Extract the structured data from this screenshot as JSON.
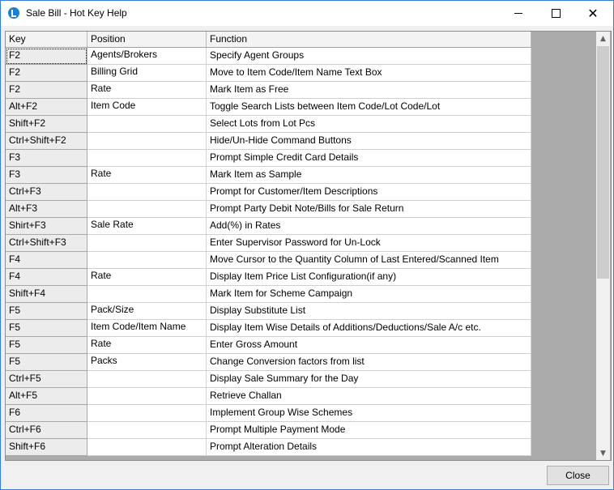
{
  "window": {
    "title": "Sale Bill - Hot Key Help",
    "icon": "app-logo-icon",
    "controls": {
      "minimize": "minimize-icon",
      "maximize": "maximize-icon",
      "close": "close-icon",
      "close_glyph": "✕"
    }
  },
  "grid": {
    "columns": [
      "Key",
      "Position",
      "Function"
    ],
    "rows": [
      {
        "key": "F2",
        "position": "Agents/Brokers",
        "function": "Specify Agent Groups"
      },
      {
        "key": "F2",
        "position": "Billing Grid",
        "function": "Move to Item Code/Item Name Text Box"
      },
      {
        "key": "F2",
        "position": "Rate",
        "function": "Mark Item as Free"
      },
      {
        "key": "Alt+F2",
        "position": "Item Code",
        "function": "Toggle Search Lists between Item Code/Lot Code/Lot"
      },
      {
        "key": "Shift+F2",
        "position": "",
        "function": "Select Lots from Lot Pcs"
      },
      {
        "key": "Ctrl+Shift+F2",
        "position": "",
        "function": "Hide/Un-Hide Command Buttons"
      },
      {
        "key": "F3",
        "position": "",
        "function": "Prompt Simple Credit Card Details"
      },
      {
        "key": "F3",
        "position": "Rate",
        "function": "Mark Item as Sample"
      },
      {
        "key": "Ctrl+F3",
        "position": "",
        "function": "Prompt for Customer/Item Descriptions"
      },
      {
        "key": "Alt+F3",
        "position": "",
        "function": "Prompt Party Debit Note/Bills for Sale Return"
      },
      {
        "key": "Shirt+F3",
        "position": "Sale Rate",
        "function": "Add(%) in Rates"
      },
      {
        "key": "Ctrl+Shift+F3",
        "position": "",
        "function": "Enter Supervisor Password for Un-Lock"
      },
      {
        "key": "F4",
        "position": "",
        "function": "Move Cursor to the Quantity Column of Last Entered/Scanned Item"
      },
      {
        "key": "F4",
        "position": "Rate",
        "function": "Display Item Price List Configuration(if any)"
      },
      {
        "key": "Shift+F4",
        "position": "",
        "function": "Mark Item for Scheme Campaign"
      },
      {
        "key": "F5",
        "position": "Pack/Size",
        "function": "Display Substitute List"
      },
      {
        "key": "F5",
        "position": "Item Code/Item Name",
        "function": "Display Item Wise Details of Additions/Deductions/Sale A/c etc."
      },
      {
        "key": "F5",
        "position": "Rate",
        "function": "Enter Gross Amount"
      },
      {
        "key": "F5",
        "position": "Packs",
        "function": "Change Conversion factors from list"
      },
      {
        "key": "Ctrl+F5",
        "position": "",
        "function": "Display Sale Summary for the Day"
      },
      {
        "key": "Alt+F5",
        "position": "",
        "function": "Retrieve Challan"
      },
      {
        "key": "F6",
        "position": "",
        "function": "Implement Group Wise Schemes"
      },
      {
        "key": "Ctrl+F6",
        "position": "",
        "function": "Prompt Multiple Payment Mode"
      },
      {
        "key": "Shift+F6",
        "position": "",
        "function": "Prompt Alteration Details"
      }
    ],
    "selected_row": 0,
    "scrollbar": {
      "up_icon": "scroll-up-icon",
      "down_icon": "scroll-down-icon",
      "up_glyph": "▲",
      "down_glyph": "▼"
    }
  },
  "footer": {
    "close_label": "Close"
  }
}
